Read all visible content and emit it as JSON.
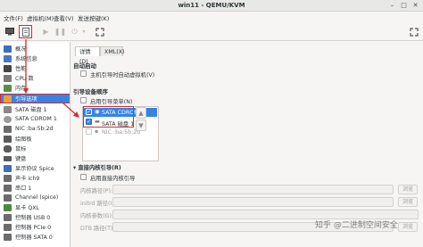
{
  "window": {
    "title": "win11 - QEMU/KVM",
    "minimize": "–",
    "maximize": "□",
    "close": "✕"
  },
  "menubar": [
    "文件(F)",
    "虚拟机(M)",
    "查看(V)",
    "发送按键(K)"
  ],
  "sidebar": {
    "items": [
      {
        "label": "概况",
        "icon": "info-icon",
        "color": "#3c6fb6"
      },
      {
        "label": "系统信息",
        "icon": "system-icon",
        "color": "#4a78b8"
      },
      {
        "label": "性能",
        "icon": "performance-icon",
        "color": "#444444"
      },
      {
        "label": "CPU 数",
        "icon": "cpu-icon",
        "color": "#7a7a7a"
      },
      {
        "label": "内存",
        "icon": "memory-icon",
        "color": "#5b8f3f"
      },
      {
        "label": "引导选项",
        "icon": "boot-options-icon",
        "color": "#e8a23a"
      },
      {
        "label": "SATA 磁盘 1",
        "icon": "disk-icon",
        "color": "#8a8a8a"
      },
      {
        "label": "SATA CDROM 1",
        "icon": "cdrom-icon",
        "color": "#9a9a9a"
      },
      {
        "label": "NIC :ba:5b:2d",
        "icon": "nic-icon",
        "color": "#6b6b6b"
      },
      {
        "label": "绘图板",
        "icon": "tablet-icon",
        "color": "#5a5a5a"
      },
      {
        "label": "鼠标",
        "icon": "mouse-icon",
        "color": "#5a5a5a"
      },
      {
        "label": "键盘",
        "icon": "keyboard-icon",
        "color": "#5a5a5a"
      },
      {
        "label": "显示协议 Spice",
        "icon": "display-icon",
        "color": "#3c6fb6"
      },
      {
        "label": "声卡 ich9",
        "icon": "sound-icon",
        "color": "#6b6b6b"
      },
      {
        "label": "串口 1",
        "icon": "serial-icon",
        "color": "#6b6b6b"
      },
      {
        "label": "Channel (spice)",
        "icon": "channel-icon",
        "color": "#6b6b6b"
      },
      {
        "label": "显卡 QXL",
        "icon": "video-icon",
        "color": "#4a8a3a"
      },
      {
        "label": "控制器 USB 0",
        "icon": "usb-controller-icon",
        "color": "#6b6b6b"
      },
      {
        "label": "控制器 PCIe 0",
        "icon": "pcie-controller-icon",
        "color": "#6b6b6b"
      },
      {
        "label": "控制器 SATA 0",
        "icon": "sata-controller-icon",
        "color": "#6b6b6b"
      }
    ],
    "selected_index": 5
  },
  "tabs": [
    "详情(D)",
    "XML(X)"
  ],
  "autostart": {
    "title": "自动启动",
    "checkbox_label": "主机引导时自动虚拟机(V)"
  },
  "boot_order": {
    "title": "引导设备顺序",
    "enable_menu_label": "启用引导菜单(N)",
    "devices": [
      {
        "label": "SATA CDROM 1",
        "checked": true,
        "selected": true
      },
      {
        "label": "SATA 磁盘 1",
        "checked": true,
        "selected": false
      },
      {
        "label": "NIC :ba:5b:2d",
        "checked": false,
        "selected": false
      }
    ],
    "up_arrow": "▲",
    "down_arrow": "▼"
  },
  "direct_kernel": {
    "title": "直接内核引导(R)",
    "enable_label": "启用直接内核引导",
    "fields": [
      {
        "label": "内核路径(P):",
        "browse": "浏览"
      },
      {
        "label": "initrd 路径(I):",
        "browse": "浏览"
      },
      {
        "label": "内核参数(G):",
        "browse": ""
      },
      {
        "label": "DTB 路径(T):",
        "browse": "浏览"
      }
    ]
  },
  "watermark": "知乎 @二进制空间安全"
}
